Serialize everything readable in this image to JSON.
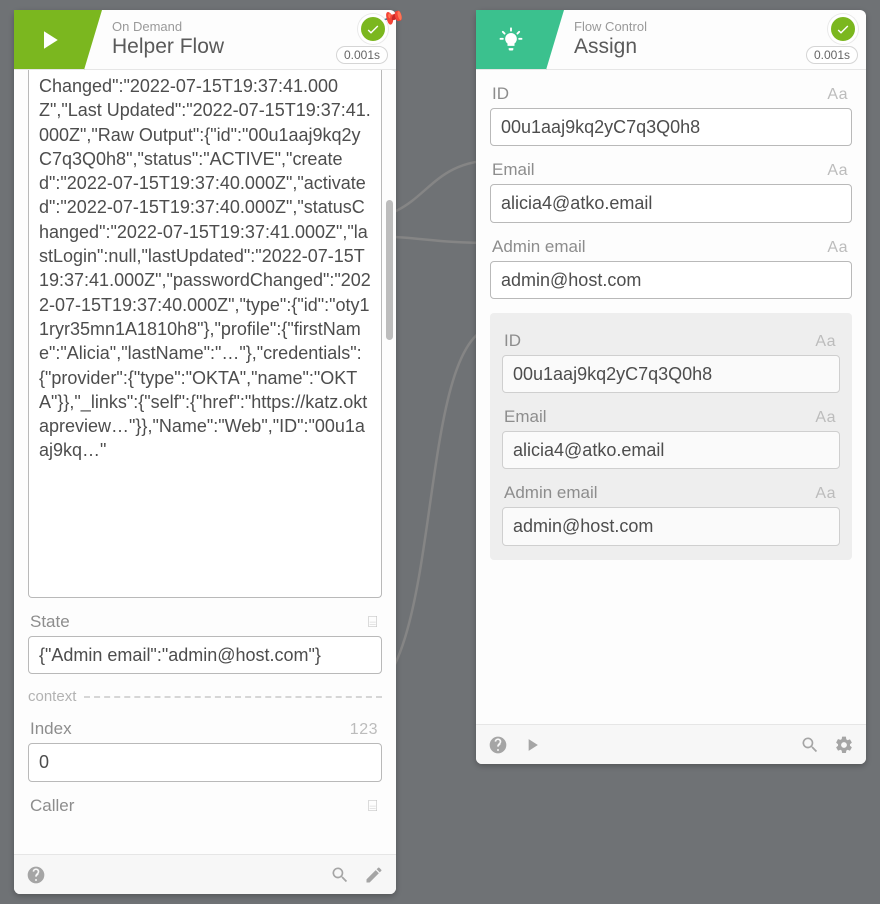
{
  "cards": {
    "helper": {
      "subtitle": "On Demand",
      "title": "Helper Flow",
      "timing": "0.001s",
      "payload_text": "Changed\":\"2022-07-15T19:37:41.000Z\",\"Last Updated\":\"2022-07-15T19:37:41.000Z\",\"Raw Output\":{\"id\":\"00u1aaj9kq2yC7q3Q0h8\",\"status\":\"ACTIVE\",\"created\":\"2022-07-15T19:37:40.000Z\",\"activated\":\"2022-07-15T19:37:40.000Z\",\"statusChanged\":\"2022-07-15T19:37:41.000Z\",\"lastLogin\":null,\"lastUpdated\":\"2022-07-15T19:37:41.000Z\",\"passwordChanged\":\"2022-07-15T19:37:40.000Z\",\"type\":{\"id\":\"oty11ryr35mn1A1810h8\"},\"profile\":{\"firstName\":\"Alicia\",\"lastName\":\"…\"},\"credentials\":{\"provider\":{\"type\":\"OKTA\",\"name\":\"OKTA\"}},\"_links\":{\"self\":{\"href\":\"https://katz.oktapreview…\"}},\"Name\":\"Web\",\"ID\":\"00u1aaj9kq…\"",
      "state_label": "State",
      "state_type": "⌸",
      "state_value": "{\"Admin email\":\"admin@host.com\"}",
      "context_label": "context",
      "index_label": "Index",
      "index_type": "123",
      "index_value": "0",
      "caller_label": "Caller",
      "caller_type": "⌸"
    },
    "assign": {
      "subtitle": "Flow Control",
      "title": "Assign",
      "timing": "0.001s",
      "type_text": "Aa",
      "inputs": {
        "id_label": "ID",
        "id_value": "00u1aaj9kq2yC7q3Q0h8",
        "email_label": "Email",
        "email_value": "alicia4@atko.email",
        "admin_label": "Admin email",
        "admin_value": "admin@host.com"
      },
      "outputs": {
        "id_label": "ID",
        "id_value": "00u1aaj9kq2yC7q3Q0h8",
        "email_label": "Email",
        "email_value": "alicia4@atko.email",
        "admin_label": "Admin email",
        "admin_value": "admin@host.com"
      }
    }
  }
}
